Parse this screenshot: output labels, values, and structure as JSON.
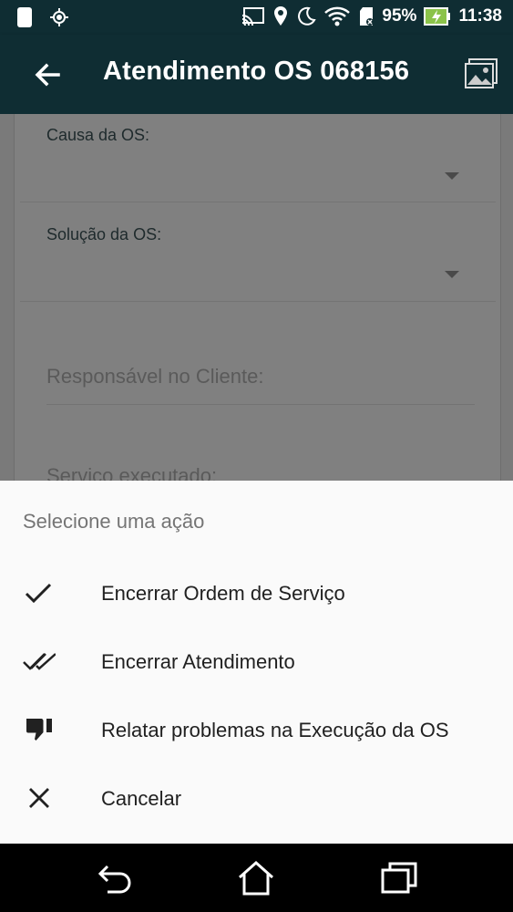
{
  "status_bar": {
    "battery_percent": "95%",
    "time": "11:38",
    "icons": [
      "phone-icon",
      "gps-icon",
      "cast-icon",
      "location-pin-icon",
      "moon-icon",
      "wifi-icon",
      "sd-card-icon",
      "battery-charging-icon"
    ]
  },
  "app_bar": {
    "title": "Atendimento OS 068156",
    "back_icon": "arrow-left-icon",
    "action_icon": "gallery-icon"
  },
  "form": {
    "causa_label": "Causa da OS:",
    "solucao_label": "Solução da OS:",
    "responsavel_placeholder": "Responsável no Cliente:",
    "servico_placeholder": "Serviço executado:"
  },
  "sheet": {
    "heading": "Selecione uma ação",
    "actions": [
      {
        "label": "Encerrar Ordem de Serviço",
        "icon": "check-icon"
      },
      {
        "label": "Encerrar Atendimento",
        "icon": "double-check-icon"
      },
      {
        "label": "Relatar problemas na Execução da OS",
        "icon": "thumbs-down-icon"
      },
      {
        "label": "Cancelar",
        "icon": "close-icon"
      }
    ]
  },
  "nav_bar": {
    "icons": [
      "back-nav-icon",
      "home-nav-icon",
      "recents-nav-icon"
    ]
  },
  "colors": {
    "primary_dark": "#0f2d33",
    "sheet_bg": "#fafafa",
    "scrim_overlay": "#808080"
  }
}
